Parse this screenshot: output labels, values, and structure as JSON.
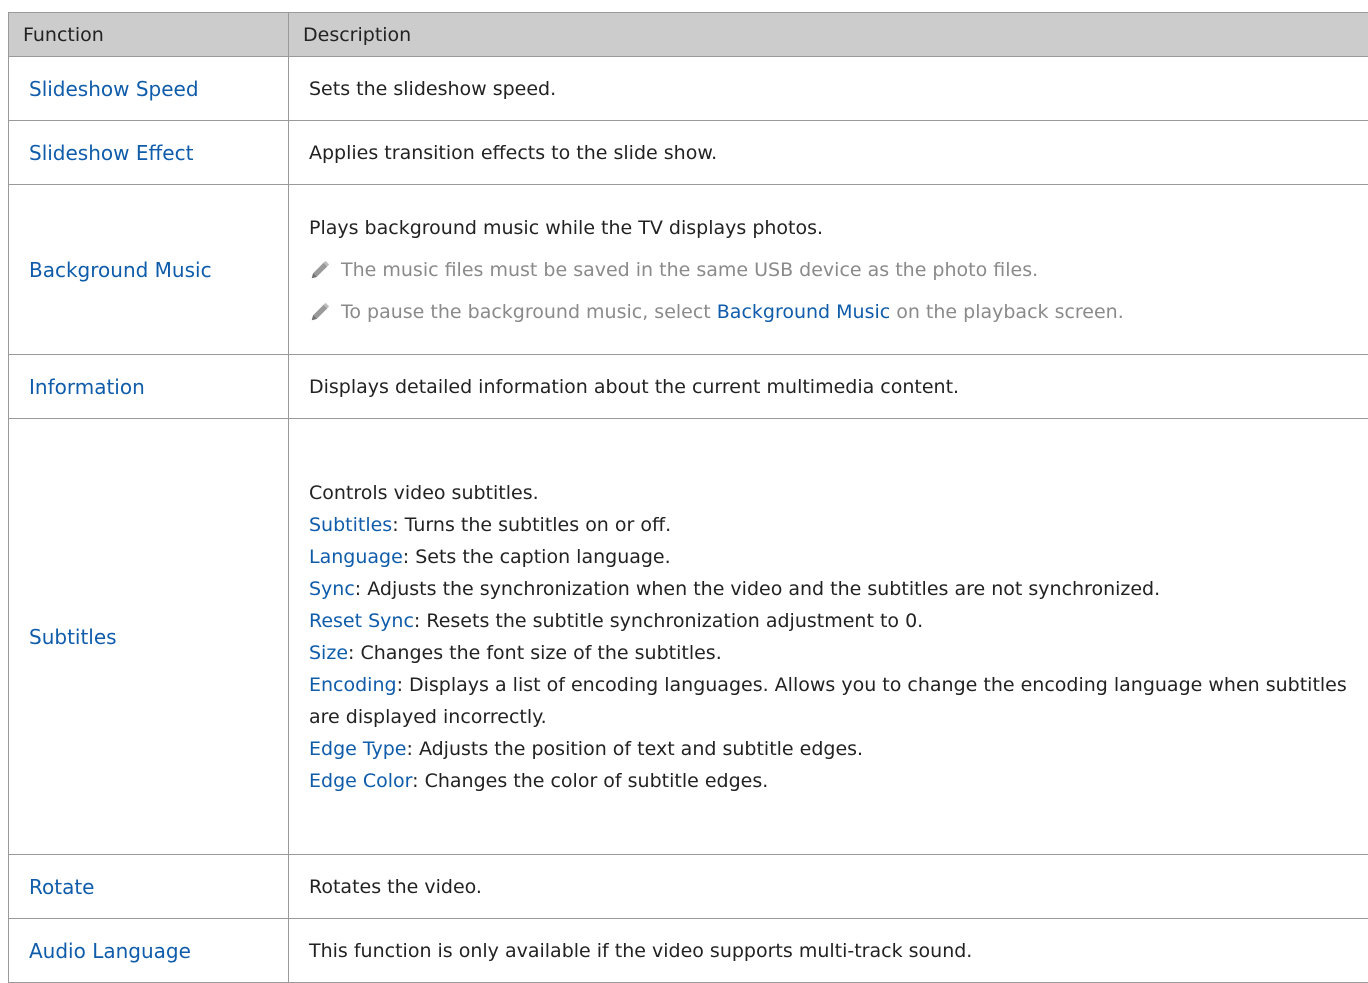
{
  "table": {
    "headers": {
      "function": "Function",
      "description": "Description"
    },
    "rows": {
      "slideshow_speed": {
        "function": "Slideshow Speed",
        "description": "Sets the slideshow speed."
      },
      "slideshow_effect": {
        "function": "Slideshow Effect",
        "description": "Applies transition effects to the slide show."
      },
      "background_music": {
        "function": "Background Music",
        "description": "Plays background music while the TV displays photos.",
        "note1": "The music files must be saved in the same USB device as the photo files.",
        "note2_pre": "To pause the background music, select",
        "note2_link": "Background Music",
        "note2_post": "on the playback screen."
      },
      "information": {
        "function": "Information",
        "description": "Displays detailed information about the current multimedia content."
      },
      "subtitles": {
        "function": "Subtitles",
        "intro": "Controls video subtitles.",
        "items": {
          "subtitles": {
            "label": "Subtitles",
            "text": ": Turns the subtitles on or off."
          },
          "language": {
            "label": "Language",
            "text": ": Sets the caption language."
          },
          "sync": {
            "label": "Sync",
            "text": ": Adjusts the synchronization when the video and the subtitles are not synchronized."
          },
          "reset_sync": {
            "label": "Reset Sync",
            "text": ": Resets the subtitle synchronization adjustment to 0."
          },
          "size": {
            "label": "Size",
            "text": ": Changes the font size of the subtitles."
          },
          "encoding": {
            "label": "Encoding",
            "text": ": Displays a list of encoding languages. Allows you to change the encoding language when subtitles are displayed incorrectly."
          },
          "edge_type": {
            "label": "Edge Type",
            "text": ": Adjusts the position of text and subtitle edges."
          },
          "edge_color": {
            "label": "Edge Color",
            "text": ": Changes the color of subtitle edges."
          }
        }
      },
      "rotate": {
        "function": "Rotate",
        "description": "Rotates the video."
      },
      "audio_language": {
        "function": "Audio Language",
        "description": "This function is only available if the video supports multi-track sound."
      }
    }
  },
  "icons": {
    "note_icon": "pencil-icon"
  },
  "colors": {
    "link": "#0f5cab",
    "header_bg": "#cccccc",
    "note_text": "#8a8a8a",
    "border": "#9a9a9a"
  }
}
